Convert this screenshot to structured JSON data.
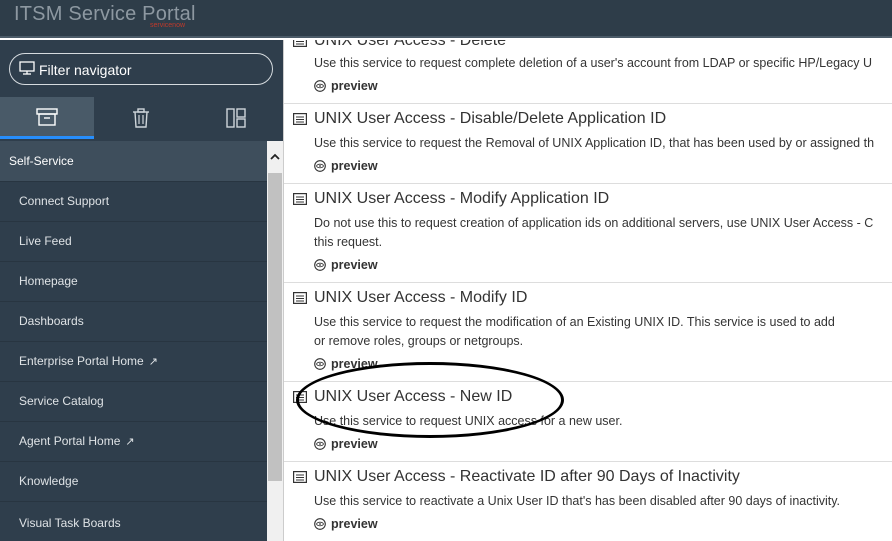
{
  "banner": {
    "title": "ITSM Service Portal",
    "subtitle": "servicenow"
  },
  "sidebar": {
    "filter_placeholder": "Filter navigator",
    "section_label": "Self-Service",
    "items": [
      {
        "label": "Connect Support",
        "external": false
      },
      {
        "label": "Live Feed",
        "external": false
      },
      {
        "label": "Homepage",
        "external": false
      },
      {
        "label": "Dashboards",
        "external": false
      },
      {
        "label": "Enterprise Portal Home",
        "external": true
      },
      {
        "label": "Service Catalog",
        "external": false
      },
      {
        "label": "Agent Portal Home",
        "external": true
      },
      {
        "label": "Knowledge",
        "external": false
      },
      {
        "label": "Visual Task Boards",
        "external": false
      }
    ],
    "external_glyph": "↗"
  },
  "catalog": {
    "preview_label": "preview",
    "items": [
      {
        "title": "UNIX User Access - Delete",
        "desc_lines": [
          "Use this service to request complete deletion of a user's account from LDAP or specific HP/Legacy U"
        ]
      },
      {
        "title": "UNIX User Access - Disable/Delete Application ID",
        "desc_lines": [
          "Use this service to request the Removal of UNIX Application ID, that has been used by or assigned th"
        ]
      },
      {
        "title": "UNIX User Access - Modify Application ID",
        "desc_lines": [
          "Do not use this to request creation of application ids on additional servers, use UNIX User Access - C",
          "this request."
        ]
      },
      {
        "title": "UNIX User Access - Modify ID",
        "desc_lines": [
          "Use this service to request the modification of an Existing UNIX ID. This service is used to add",
          "or remove roles, groups or netgroups."
        ]
      },
      {
        "title": "UNIX User Access - New ID",
        "desc_lines": [
          "Use this service to request UNIX access for a new user."
        ]
      },
      {
        "title": "UNIX User Access - Reactivate ID after 90 Days of Inactivity",
        "desc_lines": [
          "Use this service to reactivate a Unix User ID that's has been disabled after 90 days of inactivity."
        ]
      }
    ]
  },
  "colors": {
    "accent": "#278efc",
    "sidebar_bg": "#2f3e4c",
    "banner_bg": "#2e3d49"
  },
  "icons": [
    "monitor-icon",
    "archive-icon",
    "trash-icon",
    "layout-icon",
    "catalog-item-icon",
    "eye-icon",
    "chevron-up-icon",
    "external-link-icon"
  ]
}
